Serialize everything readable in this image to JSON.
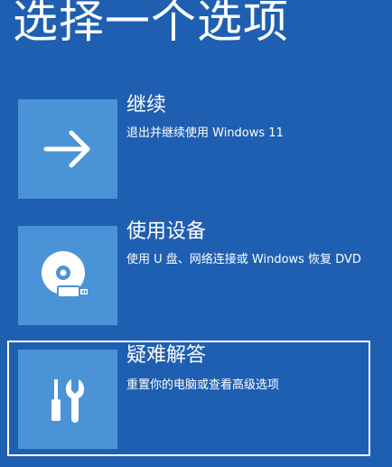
{
  "header": {
    "title": "选择一个选项"
  },
  "options": [
    {
      "title": "继续",
      "description": "退出并继续使用 Windows 11",
      "icon": "arrow-right-icon"
    },
    {
      "title": "使用设备",
      "description": "使用 U 盘、网络连接或 Windows 恢复 DVD",
      "icon": "disc-usb-icon"
    },
    {
      "title": "疑难解答",
      "description": "重置你的电脑或查看高级选项",
      "icon": "tools-icon",
      "selected": true
    }
  ],
  "colors": {
    "background": "#1f5fb1",
    "tile": "#4a93d6",
    "text": "#ffffff"
  }
}
